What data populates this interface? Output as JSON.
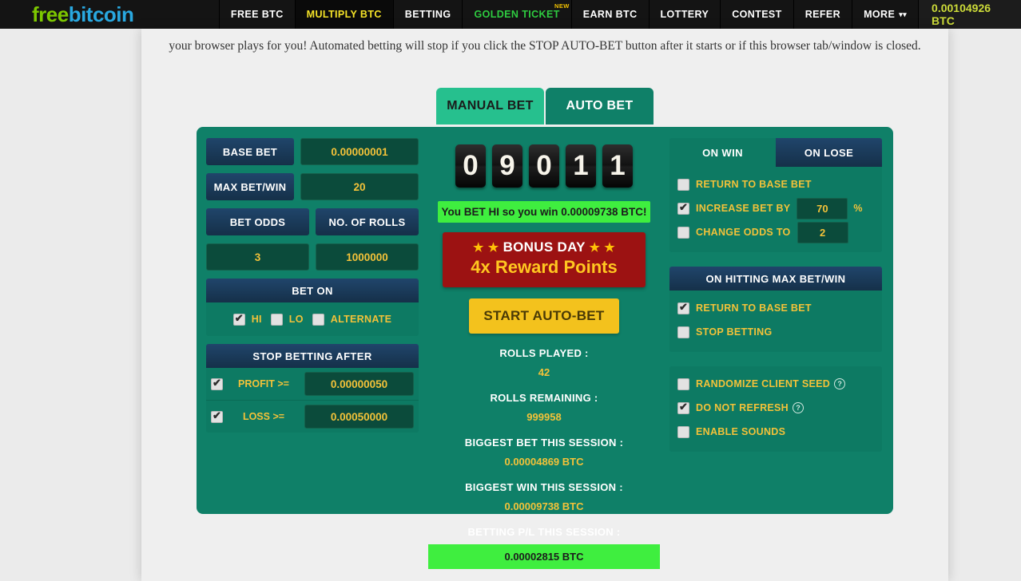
{
  "nav": {
    "logo_free": "free",
    "logo_bitcoin": "bitcoin",
    "items": [
      {
        "label": "FREE BTC",
        "state": "normal"
      },
      {
        "label": "MULTIPLY BTC",
        "state": "active"
      },
      {
        "label": "BETTING",
        "state": "normal"
      },
      {
        "label": "GOLDEN TICKET",
        "state": "golden",
        "tag": "NEW"
      },
      {
        "label": "EARN BTC",
        "state": "normal"
      },
      {
        "label": "LOTTERY",
        "state": "normal"
      },
      {
        "label": "CONTEST",
        "state": "normal"
      },
      {
        "label": "REFER",
        "state": "normal"
      },
      {
        "label": "MORE",
        "state": "normal",
        "chevron": "❯"
      }
    ],
    "balance": "0.00104926 BTC"
  },
  "intro": {
    "text": "your browser plays for you! Automated betting will stop if you click the STOP AUTO-BET button after it starts or if this browser tab/window is closed."
  },
  "tabs": {
    "manual": "MANUAL BET",
    "auto": "AUTO BET"
  },
  "left_panel": {
    "base_bet_label": "BASE BET",
    "base_bet_value": "0.00000001",
    "max_bet_win_label": "MAX BET/WIN",
    "max_bet_win_value": "20",
    "bet_odds_label": "BET ODDS",
    "bet_odds_value": "3",
    "no_of_rolls_label": "NO. OF ROLLS",
    "no_of_rolls_value": "1000000",
    "bet_on_header": "BET ON",
    "bet_on_options": [
      {
        "label": "HI",
        "checked": true
      },
      {
        "label": "LO",
        "checked": false
      },
      {
        "label": "ALTERNATE",
        "checked": false
      }
    ],
    "stop_betting_header": "STOP BETTING AFTER",
    "stop_rows": [
      {
        "label": "PROFIT >=",
        "value": "0.00000050",
        "checked": true
      },
      {
        "label": "LOSS >=",
        "value": "0.00050000",
        "checked": true
      }
    ]
  },
  "middle_panel": {
    "roll_digits": [
      "0",
      "9",
      "0",
      "1",
      "1"
    ],
    "win_message": "You BET HI so you win 0.00009738 BTC!",
    "bonus_line1": "BONUS DAY",
    "bonus_star": "★",
    "bonus_line2": "4x Reward Points",
    "start_button": "START AUTO-BET",
    "stats": [
      {
        "label": "ROLLS PLAYED :",
        "value": "42"
      },
      {
        "label": "ROLLS REMAINING :",
        "value": "999958"
      },
      {
        "label": "BIGGEST BET THIS SESSION :",
        "value": "0.00004869 BTC"
      },
      {
        "label": "BIGGEST WIN THIS SESSION :",
        "value": "0.00009738 BTC"
      }
    ],
    "pl_label": "BETTING P/L THIS SESSION :",
    "pl_value": "0.00002815 BTC"
  },
  "right_panel": {
    "on_win_tab": "ON WIN",
    "on_lose_tab": "ON LOSE",
    "win_options": [
      {
        "label": "RETURN TO BASE BET",
        "checked": false,
        "value": null,
        "suffix": null
      },
      {
        "label": "INCREASE BET BY",
        "checked": true,
        "value": "70",
        "suffix": "%"
      },
      {
        "label": "CHANGE ODDS TO",
        "checked": false,
        "value": "2",
        "suffix": null
      }
    ],
    "max_header": "ON HITTING MAX BET/WIN",
    "max_options": [
      {
        "label": "RETURN TO BASE BET",
        "checked": true
      },
      {
        "label": "STOP BETTING",
        "checked": false
      }
    ],
    "misc_options": [
      {
        "label": "RANDOMIZE CLIENT SEED",
        "checked": false,
        "help": "?"
      },
      {
        "label": "DO NOT REFRESH",
        "checked": true,
        "help": "?"
      },
      {
        "label": "ENABLE SOUNDS",
        "checked": false,
        "help": null
      }
    ]
  },
  "colors": {
    "board_green": "#0f8068",
    "panel_green": "#0d7a63",
    "label_blue": "#20456b",
    "field_dark": "#0b4b3b",
    "gold_text": "#f3c239",
    "bright_green": "#3fee3f",
    "bonus_red": "#9c1212",
    "button_gold": "#f3c21d",
    "balance_yellow": "#cddc39"
  }
}
